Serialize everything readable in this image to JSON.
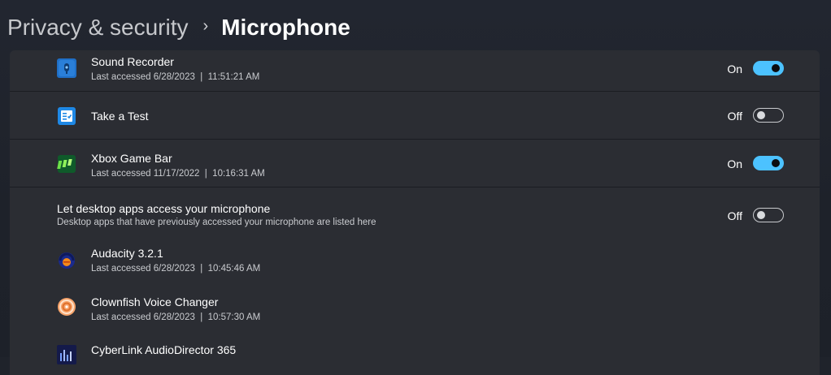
{
  "breadcrumb": {
    "parent": "Privacy & security",
    "separator": "›",
    "current": "Microphone"
  },
  "store_apps": [
    {
      "name": "Sound Recorder",
      "last_accessed": "Last accessed 6/28/2023  |  11:51:21 AM",
      "toggle_state": "On",
      "icon": "sound-recorder-icon"
    },
    {
      "name": "Take a Test",
      "last_accessed": "",
      "toggle_state": "Off",
      "icon": "take-a-test-icon"
    },
    {
      "name": "Xbox Game Bar",
      "last_accessed": "Last accessed 11/17/2022  |  10:16:31 AM",
      "toggle_state": "On",
      "icon": "xbox-game-bar-icon"
    }
  ],
  "desktop_apps": {
    "title": "Let desktop apps access your microphone",
    "description": "Desktop apps that have previously accessed your microphone are listed here",
    "toggle_state": "Off",
    "apps": [
      {
        "name": "Audacity 3.2.1",
        "last_accessed": "Last accessed 6/28/2023  |  10:45:46 AM",
        "icon": "audacity-icon"
      },
      {
        "name": "Clownfish Voice Changer",
        "last_accessed": "Last accessed 6/28/2023  |  10:57:30 AM",
        "icon": "clownfish-icon"
      },
      {
        "name": "CyberLink AudioDirector 365",
        "last_accessed": "",
        "icon": "cyberlink-audiodirector-icon"
      }
    ]
  },
  "colors": {
    "accent": "#4cc2ff",
    "panel": "#2b2d33",
    "background": "#1f232b"
  }
}
